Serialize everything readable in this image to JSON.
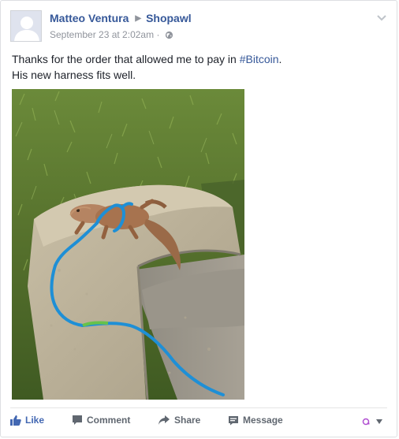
{
  "post": {
    "author": "Matteo Ventura",
    "target_page": "Shopawl",
    "timestamp": "September 23 at 2:02am",
    "meta_separator": "·",
    "text_line1_prefix": "Thanks for the order that allowed me to pay in ",
    "hashtag": "#Bitcoin",
    "text_line1_suffix": ".",
    "text_line2": "His new harness fits well.",
    "photo_icon": "photo-bearded-dragon-on-concrete"
  },
  "actions": {
    "like_label": "Like",
    "comment_label": "Comment",
    "share_label": "Share",
    "message_label": "Message"
  },
  "colors": {
    "link": "#365899",
    "like_blue": "#4267b2",
    "muted": "#90949c",
    "action_gray": "#606770"
  },
  "icons": {
    "avatar": "default-avatar-icon",
    "arrow": "triangle-right-icon",
    "privacy": "globe-icon",
    "menu": "chevron-down-icon",
    "like": "thumbs-up-icon",
    "comment": "comment-bubble-icon",
    "share": "share-arrow-icon",
    "message": "message-icon",
    "reaction": "reaction-selector-icon"
  }
}
